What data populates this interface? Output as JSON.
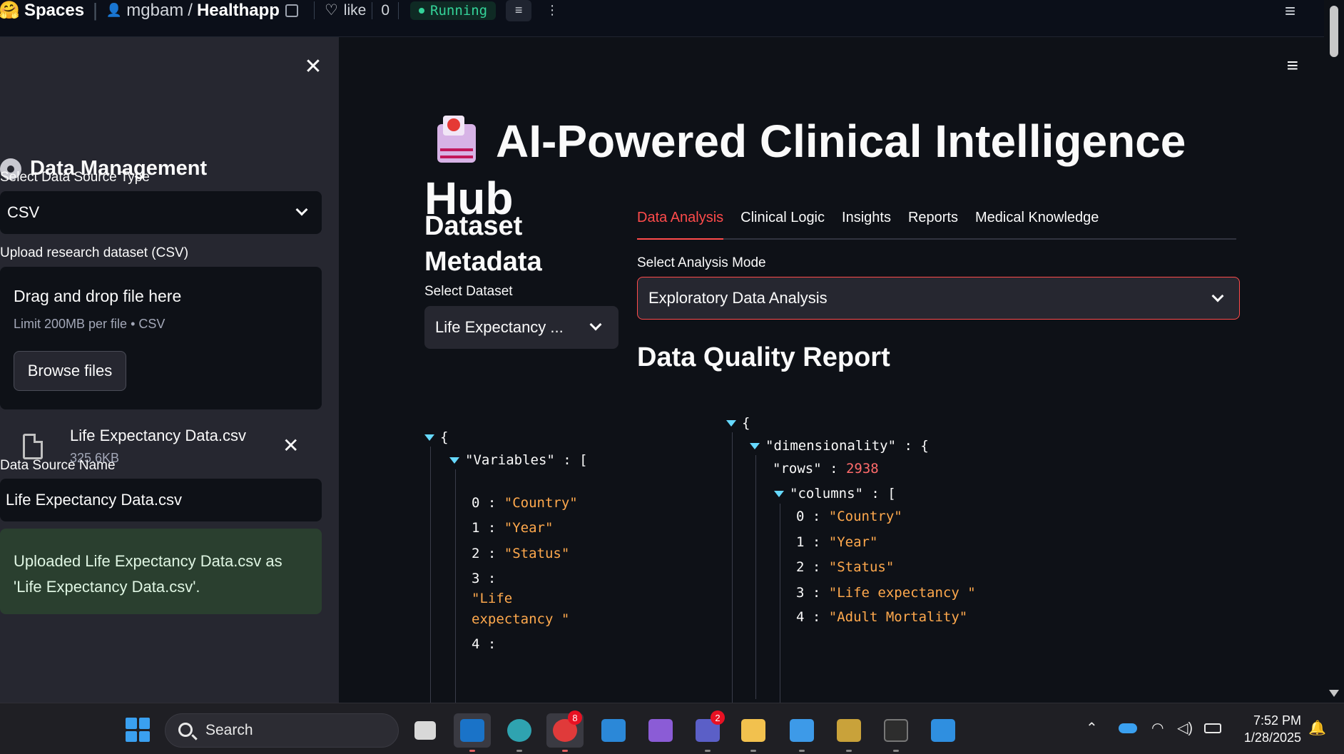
{
  "header": {
    "spaces_label": "Spaces",
    "owner": "mgbam",
    "separator": "/",
    "repo": "Healthapp",
    "like_label": "like",
    "like_count": "0",
    "status": "Running"
  },
  "sidebar": {
    "heading": "Data Management",
    "source_type_label": "Select Data Source Type",
    "source_type_value": "CSV",
    "upload_label": "Upload research dataset (CSV)",
    "drop_text": "Drag and drop file here",
    "limit_text": "Limit 200MB per file • CSV",
    "browse_label": "Browse files",
    "file_name": "Life Expectancy Data.csv",
    "file_size": "325.6KB",
    "source_name_label": "Data Source Name",
    "source_name_value": "Life Expectancy Data.csv",
    "success_message": "Uploaded Life Expectancy Data.csv as 'Life Expectancy Data.csv'."
  },
  "main": {
    "title": "AI-Powered Clinical Intelligence Hub",
    "metadata_heading": "Dataset Metadata",
    "select_dataset_label": "Select Dataset",
    "select_dataset_value": "Life Expectancy ...",
    "tabs": [
      "Data Analysis",
      "Clinical Logic",
      "Insights",
      "Reports",
      "Medical Knowledge"
    ],
    "analysis_mode_label": "Select Analysis Mode",
    "analysis_mode_value": "Exploratory Data Analysis",
    "dq_heading": "Data Quality Report"
  },
  "metadata_json": {
    "open_brace": "{",
    "variables_key": "\"Variables\"",
    "open_bracket": "[",
    "items": [
      {
        "index": "0",
        "value": "\"Country\""
      },
      {
        "index": "1",
        "value": "\"Year\""
      },
      {
        "index": "2",
        "value": "\"Status\""
      },
      {
        "index": "3",
        "value_line1": "\"Life",
        "value_line2": "expectancy \""
      },
      {
        "index": "4"
      }
    ]
  },
  "quality_json": {
    "open_brace": "{",
    "dimensionality_key": "\"dimensionality\"",
    "rows_key": "\"rows\"",
    "rows_value": "2938",
    "columns_key": "\"columns\"",
    "open_bracket": "[",
    "items": [
      {
        "index": "0",
        "value": "\"Country\""
      },
      {
        "index": "1",
        "value": "\"Year\""
      },
      {
        "index": "2",
        "value": "\"Status\""
      },
      {
        "index": "3",
        "value": "\"Life expectancy \""
      },
      {
        "index": "4",
        "value": "\"Adult Mortality\""
      }
    ]
  },
  "taskbar": {
    "search_placeholder": "Search",
    "edge_badge": "8",
    "teams_badge": "2",
    "time": "7:52 PM",
    "date": "1/28/2025"
  },
  "icons": {
    "hf_logo": "hugging-face-emoji",
    "title_icon": "hospital-emoji",
    "heading_icon": "gear-icon"
  },
  "colors": {
    "accent": "#ff4b4b",
    "json_string": "#ffa94d",
    "json_number": "#ff6b6b",
    "success_bg": "#2a3f2f"
  }
}
